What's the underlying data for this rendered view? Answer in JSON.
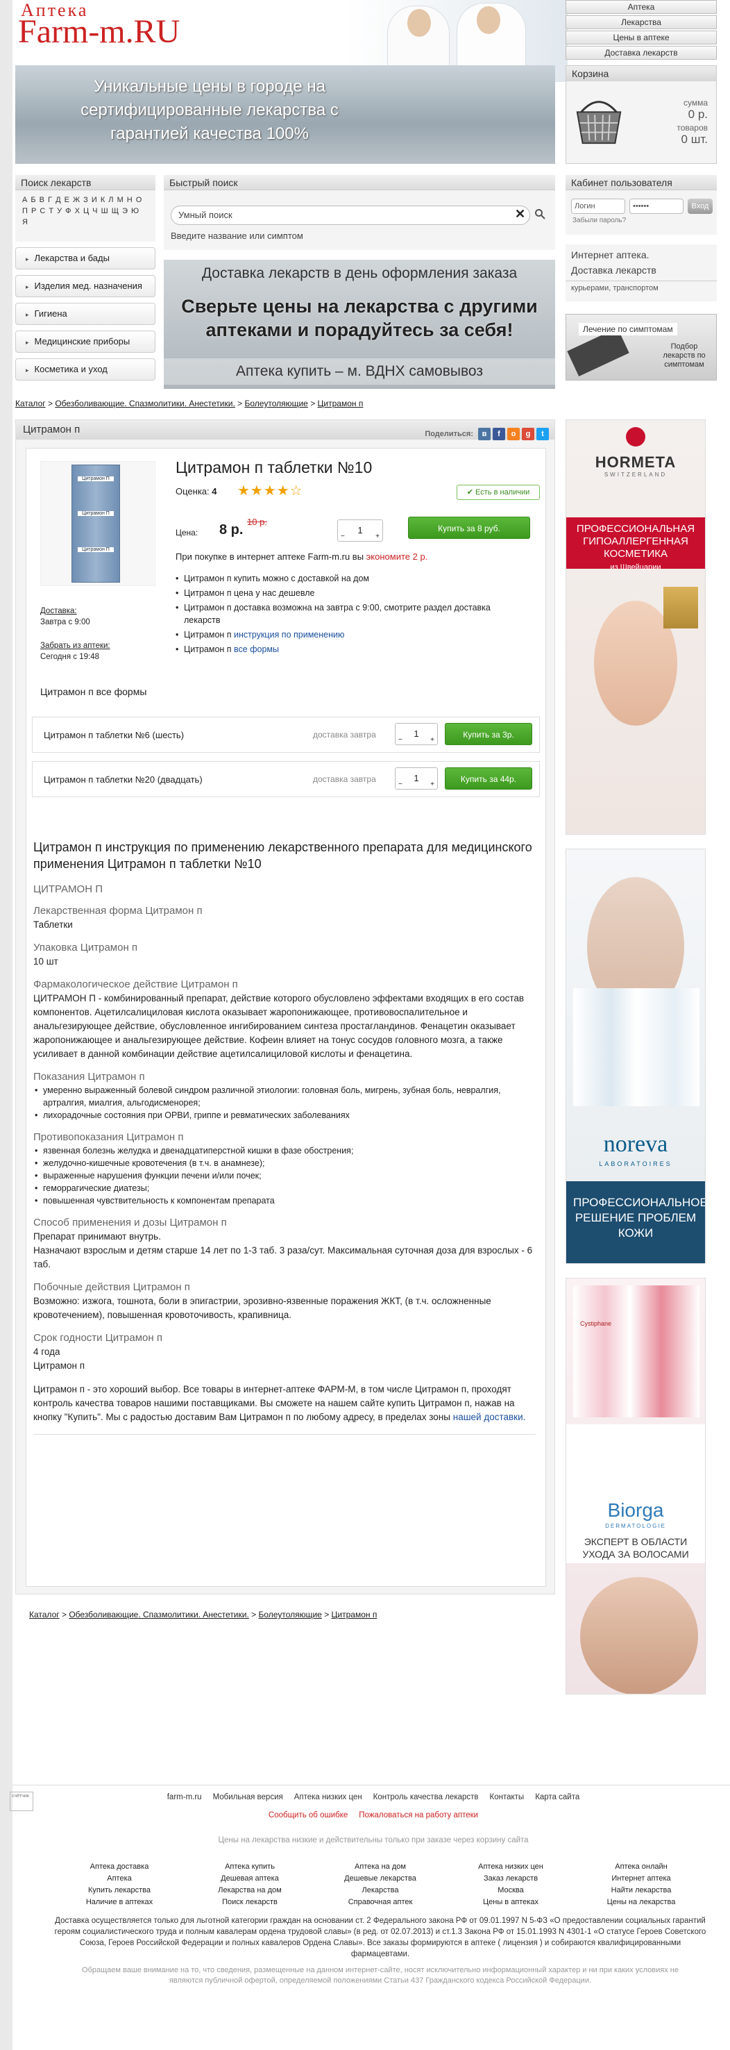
{
  "logo": {
    "top": "Аптека",
    "main": "Farm-m",
    "tld": ".RU"
  },
  "topnav": [
    "Аптека",
    "Лекарства",
    "Цены в аптеке",
    "Доставка лекарств"
  ],
  "banner": {
    "text": "Уникальные цены в городе на сертифицированные лекарства с гарантией качества 100%"
  },
  "cart": {
    "title": "Корзина",
    "sum_label": "сумма",
    "sum_value": "0 р.",
    "goods_label": "товаров",
    "goods_value": "0 шт."
  },
  "search_panel": {
    "title": "Поиск лекарств",
    "letters1": "А Б В Г Д Е Ж З И К Л М Н О",
    "letters2": "П Р С Т У Ф Х Ц Ч Ш Щ Э Ю Я"
  },
  "quick": {
    "title": "Быстрый поиск",
    "placeholder": "Умный поиск",
    "hint": "Введите название или симптом"
  },
  "cabinet": {
    "title": "Кабинет пользователя",
    "login": "Логин",
    "password": "••••••",
    "btn": "Вход",
    "forgot": "Забыли пароль?"
  },
  "categories": [
    "Лекарства и бады",
    "Изделия мед. назначения",
    "Гигиена",
    "Медицинские приборы",
    "Косметика и уход"
  ],
  "promo": {
    "line1": "Доставка лекарств в день оформления заказа",
    "line2": "Сверьте цены на лекарства с другими аптеками и порадуйтесь за себя!",
    "line3": "Аптека купить – м. ВДНХ самовывоз"
  },
  "ia": {
    "title": "Интернет аптека.",
    "title2": "Доставка лекарств",
    "sub": "курьерами, транспортом"
  },
  "symptoms": {
    "title": "Лечение по симптомам",
    "sub": "Подбор лекарств по симптомам"
  },
  "breadcrumbs": [
    "Каталог",
    "Обезболивающие. Спазмолитики. Анестетики.",
    "Болеутоляющие",
    "Цитрамон п"
  ],
  "product": {
    "header": "Цитрамон п",
    "share": "Поделиться:",
    "title": "Цитрамон п таблетки №10",
    "rating_label": "Оценка:",
    "rating": "4",
    "instock": "Есть в наличии",
    "price_label": "Цена:",
    "price": "8 р.",
    "old_price": "10 р.",
    "qty": "1",
    "buy": "Купить за 8 руб.",
    "econ_text": "При покупке в интернет аптеке Farm-m.ru вы ",
    "econ_value": "экономите 2 р.",
    "bullets": [
      "Цитрамон п купить можно с доставкой на дом",
      "Цитрамон п цена у нас дешевле",
      "Цитрамон п доставка возможна на завтра с 9:00, смотрите раздел доставка лекарств"
    ],
    "bullet4_text": "Цитрамон п ",
    "bullet4_link": "инструкция по применению",
    "bullet5_text": "Цитрамон п ",
    "bullet5_link": "все формы",
    "delivery_label": "Доставка:",
    "delivery_value": "Завтра с 9:00",
    "pickup_label": "Забрать из аптеки:",
    "pickup_value": "Сегодня с 19:48",
    "box_top": "Цитрамон П",
    "box_mid": "Цитрамон П",
    "box_bot": "Цитрамон П"
  },
  "forms": {
    "title": "Цитрамон п все формы",
    "rows": [
      {
        "name": "Цитрамон п таблетки №6 (шесть)",
        "delivery": "доставка завтра",
        "qty": "1",
        "buy": "Купить за 3р."
      },
      {
        "name": "Цитрамон п таблетки №20 (двадцать)",
        "delivery": "доставка завтра",
        "qty": "1",
        "buy": "Купить за 44р."
      }
    ]
  },
  "instruction": {
    "title": "Цитрамон п инструкция по применению лекарственного препарата для медицинского применения Цитрамон п таблетки №10",
    "name": "ЦИТРАМОН П",
    "form_h": "Лекарственная форма Цитрамон п",
    "form": "Таблетки",
    "pack_h": "Упаковка Цитрамон п",
    "pack": "10 шт",
    "pharm_h": "Фармакологическое действие Цитрамон п",
    "pharm": "ЦИТРАМОН П - комбинированный препарат, действие которого обусловлено эффектами входящих в его состав компонентов. Ацетилсалициловая кислота оказывает жаропонижающее, противовоспалительное и анальгезирующее действие, обусловленное ингибированием синтеза простагландинов. Фенацетин оказывает жаропонижающее и анальгезирующее действие. Кофеин влияет на тонус сосудов головного мозга, а также усиливает в данной комбинации действие ацетилсалициловой кислоты и фенацетина.",
    "ind_h": "Показания Цитрамон п",
    "ind": [
      "умеренно выраженный болевой синдром различной этиологии: головная боль, мигрень, зубная боль, невралгия, артралгия, миалгия, альгодисменорея;",
      "лихорадочные состояния при ОРВИ, гриппе и ревматических заболеваниях"
    ],
    "contra_h": "Противопоказания Цитрамон п",
    "contra": [
      "язвенная болезнь желудка и двенадцатиперстной кишки в фазе обострения;",
      "желудочно-кишечные кровотечения (в т.ч. в анамнезе);",
      "выраженные нарушения функции печени и/или почек;",
      "геморрагические диатезы;",
      "повышенная чувствительность к компонентам препарата"
    ],
    "dose_h": "Способ применения и дозы Цитрамон п",
    "dose1": "Препарат принимают внутрь.",
    "dose2": "Назначают взрослым и детям старше 14 лет по 1-3 таб. 3 раза/сут. Максимальная суточная доза для взрослых - 6 таб.",
    "side_h": "Побочные действия Цитрамон п",
    "side": "Возможно: изжога, тошнота, боли в эпигастрии, эрозивно-язвенные поражения ЖКТ, (в т.ч. осложненные кровотечением), повышенная кровоточивость, крапивница.",
    "shelf_h": "Срок годности Цитрамон п",
    "shelf1": "4 года",
    "shelf2": "Цитрамон п",
    "outro": "Цитрамон п - это хороший выбор. Все товары в интернет-аптеке ФАРМ-М, в том числе Цитрамон п, проходят контроль качества товаров нашими поставщиками. Вы сможете на нашем сайте купить Цитрамон п, нажав на кнопку \"Купить\". Мы с радостью доставим Вам Цитрамон п по любому адресу, в пределах зоны ",
    "outro_link": "нашей доставки."
  },
  "ads": {
    "hormeta_brand": "HORMETA",
    "hormeta_sub": "SWITZERLAND",
    "hormeta_text": "ПРОФЕССИОНАЛЬНАЯ ГИПОАЛЛЕРГЕННАЯ КОСМЕТИКА",
    "hormeta_from": "из Швейцарии",
    "noreva_brand": "noreva",
    "noreva_sub": "LABORATOIRES",
    "noreva_text": "ПРОФЕССИОНАЛЬНОЕ РЕШЕНИЕ ПРОБЛЕМ КОЖИ",
    "biorga_brand": "Biorga",
    "biorga_sub": "DERMATOLOGIE",
    "biorga_text": "ЭКСПЕРТ В ОБЛАСТИ УХОДА ЗА ВОЛОСАМИ",
    "product_label": "Cystiphane"
  },
  "footer": {
    "links": [
      "farm-m.ru",
      "Мобильная версия",
      "Аптека низких цен",
      "Контроль качества лекарств",
      "Контакты",
      "Карта сайта"
    ],
    "report": "Сообщить об ошибке",
    "complain": "Пожаловаться на работу аптеки",
    "note": "Цены на лекарства низкие и действительны только при заказе через корзину сайта",
    "cols": [
      [
        "Аптека доставка",
        "Аптека",
        "Купить лекарства",
        "Наличие в аптеках"
      ],
      [
        "Аптека купить",
        "Дешевая аптека",
        "Лекарства на дом",
        "Поиск лекарств"
      ],
      [
        "Аптека на дом",
        "Дешевые лекарства",
        "Лекарства",
        "Справочная аптек"
      ],
      [
        "Аптека низких цен",
        "Заказ лекарств",
        "Москва",
        "Цены в аптеках"
      ],
      [
        "Аптека онлайн",
        "Интернет аптека",
        "Найти лекарства",
        "Цены на лекарства"
      ]
    ],
    "legal": "Доставка осуществляется только для льготной категории граждан на основании ст. 2 Федерального закона РФ от 09.01.1997 N 5-ФЗ «О предоставлении социальных гарантий героям социалистического труда и полным кавалерам ордена трудовой славы» (в ред. от 02.07.2013) и ст.1.3 Закона РФ от 15.01.1993 N 4301-1 «О статусе Героев Советского Союза, Героев Российской Федерации и полных кавалеров Ордена Славы». Все заказы формируются в аптеке ( лицензия ) и собираются квалифицированными фармацевтами.",
    "disclaimer": "Обращаем ваше внимание на то, что сведения, размещенные на данном интернет-сайте, носят исключительно информационный характер и ни при каких условиях не являются публичной офертой, определяемой положениями Статьи 437 Гражданского кодекса Российской Федерации.",
    "counter": "счётчик"
  }
}
